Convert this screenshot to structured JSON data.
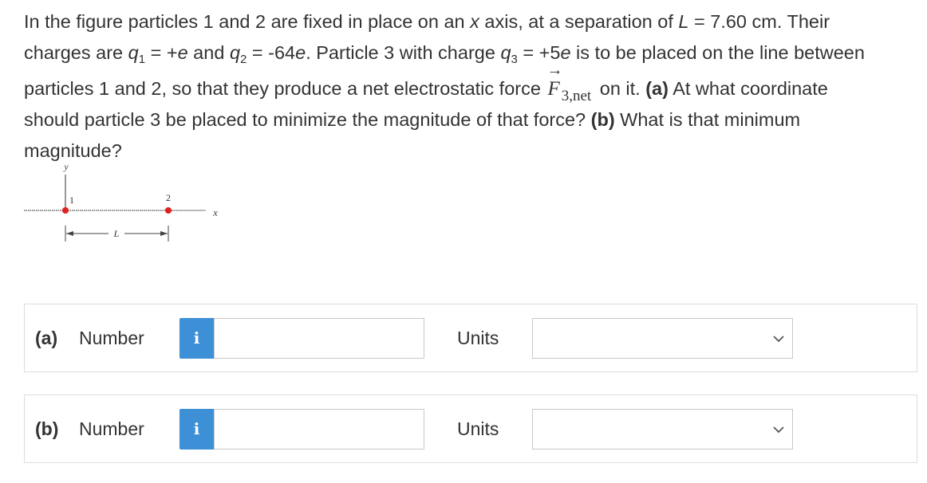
{
  "question": {
    "line1_a": "In the figure particles 1 and 2 are fixed in place on an ",
    "x_var": "x",
    "line1_b": " axis, at a separation of ",
    "L_var": "L",
    "line1_c": " = 7.60 cm. Their",
    "line2_a": "charges are ",
    "q_var": "q",
    "sub1": "1",
    "line2_b": " = +",
    "e_var": "e",
    "line2_c": " and ",
    "sub2": "2",
    "line2_d": " = -64",
    "line2_e": ". Particle 3 with charge ",
    "sub3": "3",
    "line2_f": " = +5",
    "line2_g": " is to be placed on the line between",
    "line3_a": "particles 1 and 2, so that they produce a net electrostatic force ",
    "F_var": "F",
    "F_arrow": "→",
    "F_sub": "3,net",
    "line3_b": "on it. ",
    "part_a_bold": "(a)",
    "line3_c": " At what coordinate",
    "line4_a": "should particle 3 be placed to minimize the magnitude of that force? ",
    "part_b_bold": "(b)",
    "line4_b": " What is that minimum",
    "line5": "magnitude?"
  },
  "figure": {
    "y_label": "y",
    "x_label": "x",
    "particle1_label": "1",
    "particle2_label": "2",
    "separation_label": "L",
    "particle_color": "#e02020"
  },
  "answers": [
    {
      "part_label": "(a)",
      "number_label": "Number",
      "info_icon": "i",
      "number_value": "",
      "units_label": "Units",
      "units_value": ""
    },
    {
      "part_label": "(b)",
      "number_label": "Number",
      "info_icon": "i",
      "number_value": "",
      "units_label": "Units",
      "units_value": ""
    }
  ],
  "colors": {
    "info_button": "#3d8fd6",
    "text": "#333333",
    "border": "#dcdcdc"
  }
}
